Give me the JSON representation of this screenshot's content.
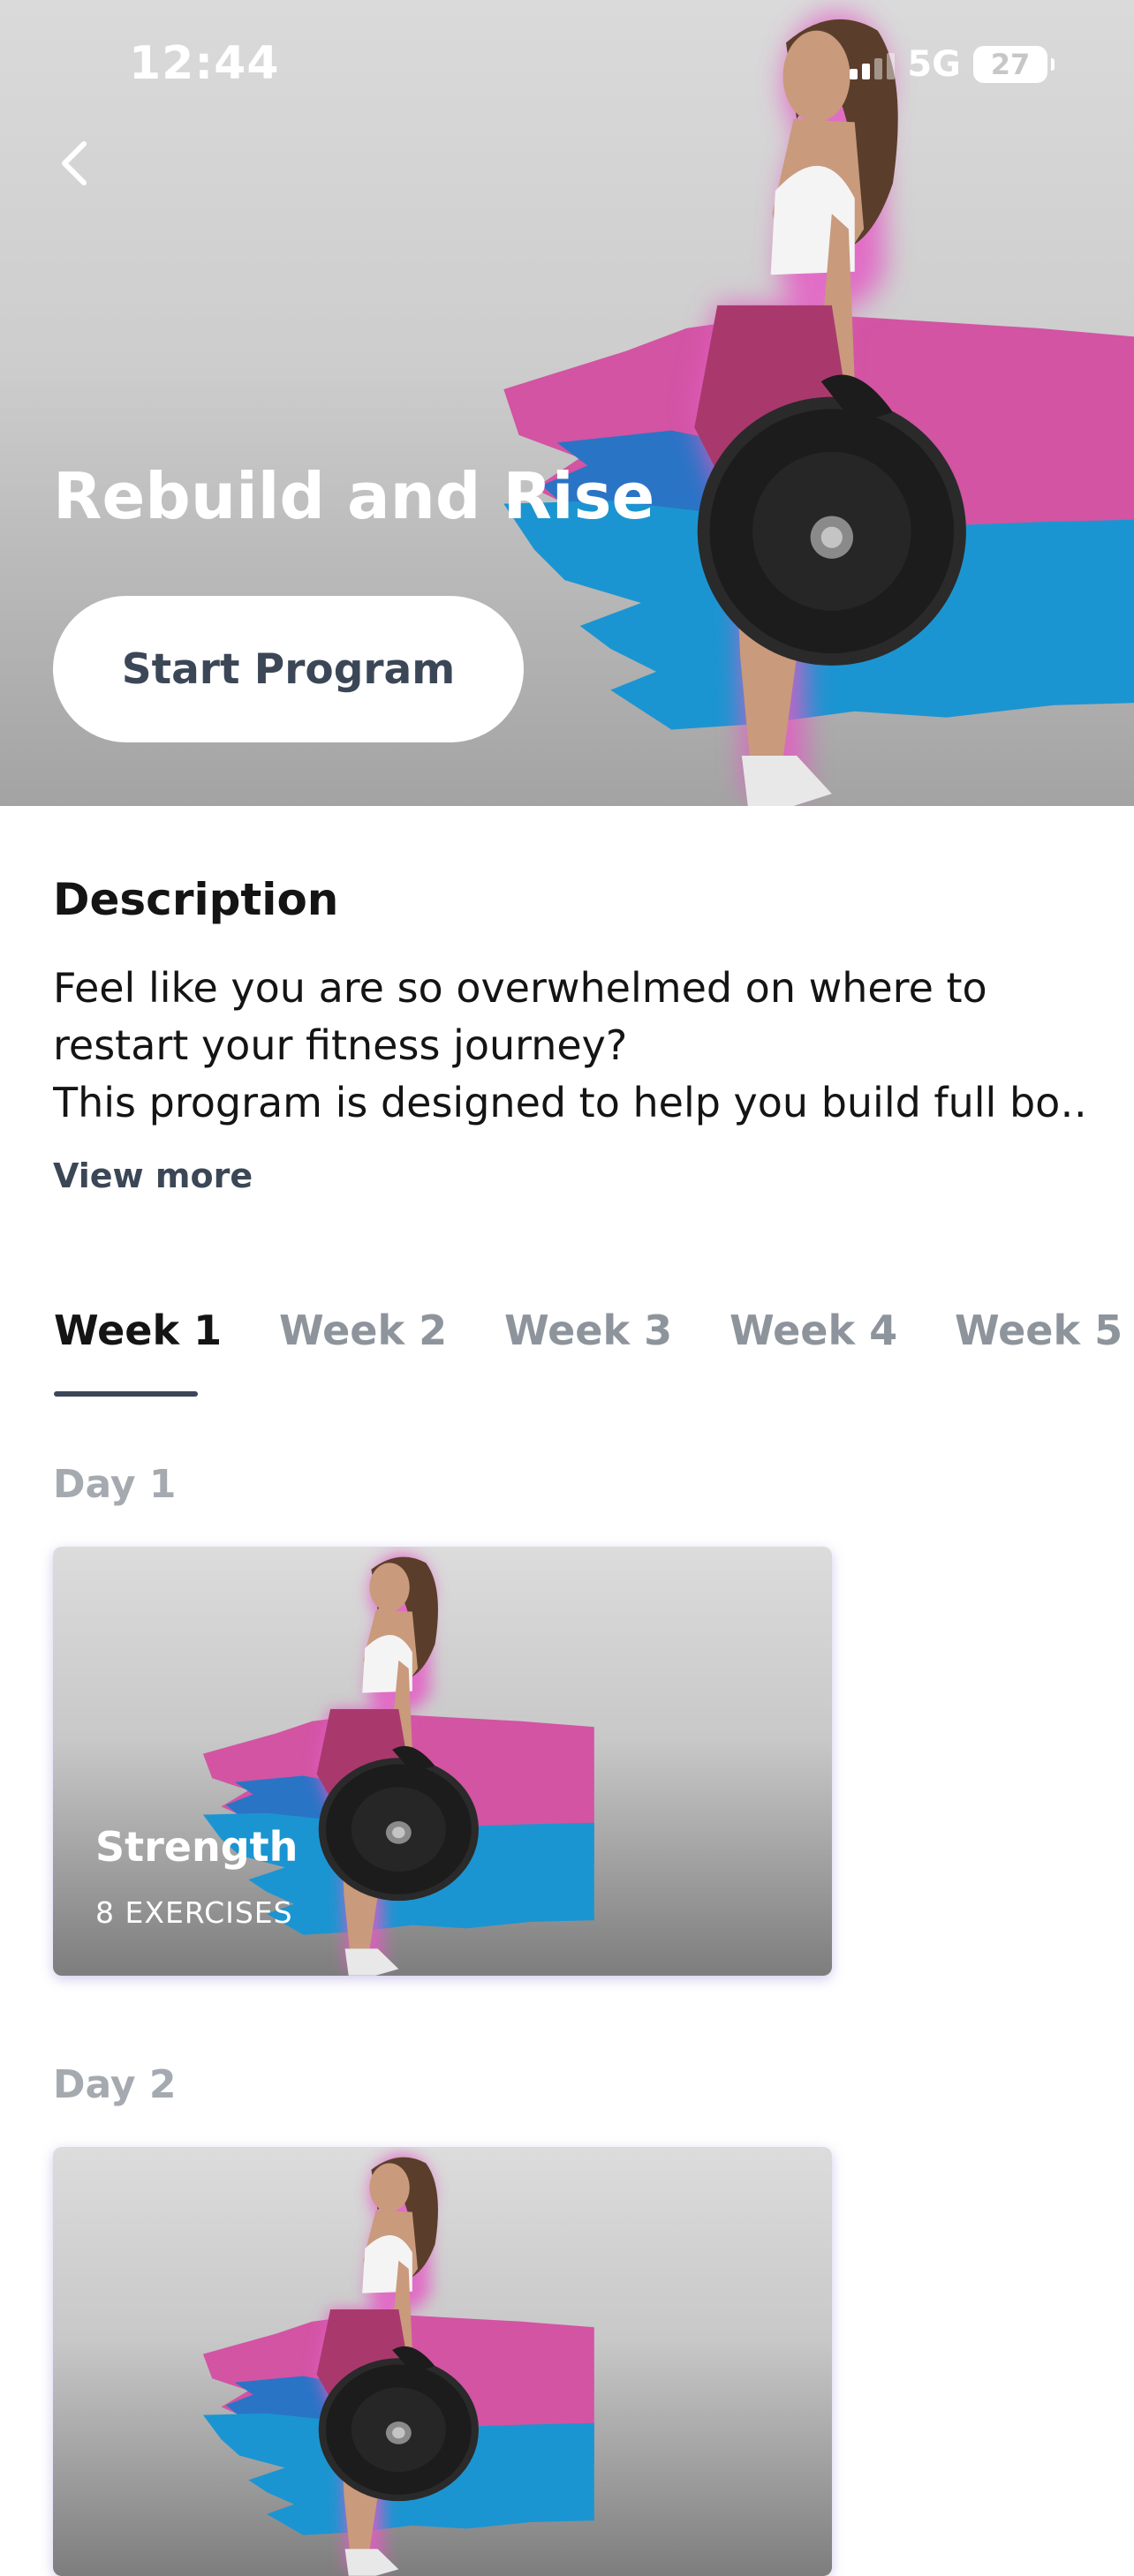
{
  "status_bar": {
    "time": "12:44",
    "network": "5G",
    "battery_level": "27"
  },
  "hero": {
    "back_icon": "chevron-left-icon",
    "title": "Rebuild and Rise",
    "start_button_label": "Start Program"
  },
  "description": {
    "heading": "Description",
    "lines": [
      "Feel like you are so overwhelmed on where to",
      "restart your fitness journey?",
      "This program is designed to help you build full bo…"
    ],
    "view_more_label": "View more"
  },
  "weeks": {
    "tabs": [
      {
        "label": "Week 1"
      },
      {
        "label": "Week 2"
      },
      {
        "label": "Week 3"
      },
      {
        "label": "Week 4"
      },
      {
        "label": "Week 5"
      }
    ],
    "selected": "Week 1"
  },
  "days": [
    {
      "label": "Day 1",
      "workout": {
        "title": "Strength",
        "subtitle": "8 EXERCISES"
      }
    },
    {
      "label": "Day 2",
      "workout": {
        "title": "",
        "subtitle": ""
      }
    }
  ],
  "colors": {
    "accent_dark": "#3b4756",
    "brush_pink": "#d254a3",
    "brush_blue": "#1b95d1",
    "inactive_tab": "#8e949c",
    "day_label": "#a5aab0"
  }
}
